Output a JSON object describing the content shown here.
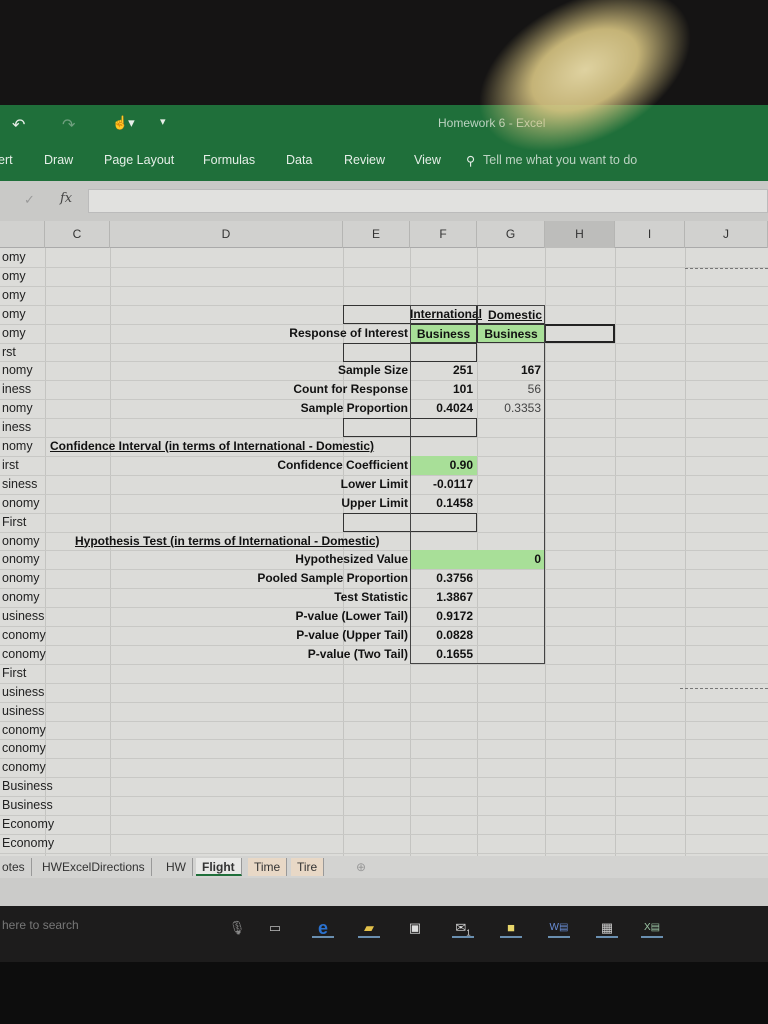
{
  "window": {
    "title": "Homework 6 - Excel"
  },
  "quick_access": {
    "undo": "↶",
    "redo": "↷",
    "touch": "☝▾",
    "customize": "▾"
  },
  "ribbon_tabs": [
    "ert",
    "Draw",
    "Page Layout",
    "Formulas",
    "Data",
    "Review",
    "View"
  ],
  "tell_me": "Tell me what you want to do",
  "formula_bar": {
    "check": "✓",
    "fx": "fx",
    "value": ""
  },
  "columns": [
    "C",
    "D",
    "E",
    "F",
    "G",
    "H",
    "I",
    "J"
  ],
  "left_column": [
    "omy",
    "omy",
    "omy",
    "omy",
    "omy",
    "rst",
    "nomy",
    "iness",
    "nomy",
    "iness",
    "nomy",
    "irst",
    "siness",
    "onomy",
    "First",
    "onomy",
    "onomy",
    "onomy",
    "onomy",
    "usiness",
    "conomy",
    "conomy",
    "First",
    "usiness",
    "usiness",
    "conomy",
    "conomy",
    "conomy",
    "Business",
    "Business",
    "Economy",
    "Economy"
  ],
  "table": {
    "headers": {
      "international": "International",
      "domestic": "Domestic"
    },
    "response_label": "Response of Interest",
    "response_values": [
      "Business",
      "Business"
    ],
    "sample": [
      {
        "label": "Sample Size",
        "f": "251",
        "g": "167"
      },
      {
        "label": "Count for Response",
        "f": "101",
        "g": "56"
      },
      {
        "label": "Sample Proportion",
        "f": "0.4024",
        "g": "0.3353"
      }
    ],
    "ci_heading": "Confidence Interval (in terms of International - Domestic)",
    "ci": [
      {
        "label": "Confidence Coefficient",
        "f": "0.90"
      },
      {
        "label": "Lower Limit",
        "f": "-0.0117"
      },
      {
        "label": "Upper Limit",
        "f": "0.1458"
      }
    ],
    "ht_heading": "Hypothesis Test (in terms of International - Domestic)",
    "ht": [
      {
        "label": "Hypothesized Value",
        "f": "0"
      },
      {
        "label": "Pooled Sample Proportion",
        "f": "0.3756"
      },
      {
        "label": "Test Statistic",
        "f": "1.3867"
      },
      {
        "label": "P-value (Lower Tail)",
        "f": "0.9172"
      },
      {
        "label": "P-value (Upper Tail)",
        "f": "0.0828"
      },
      {
        "label": "P-value (Two Tail)",
        "f": "0.1655"
      }
    ]
  },
  "sheet_tabs": [
    "otes",
    "HWExcelDirections",
    "HW",
    "Flight",
    "Time",
    "Tire"
  ],
  "active_sheet": "Flight",
  "add_sheet": "⊕",
  "taskbar": {
    "search": "here to search",
    "apps": [
      "mic",
      "task-view",
      "edge",
      "file-explorer",
      "store",
      "mail",
      "sticky-notes",
      "word",
      "calculator",
      "excel"
    ],
    "mail_badge": "1"
  },
  "colors": {
    "ribbon": "#1f6f3a",
    "input_green": "#a8df98"
  }
}
